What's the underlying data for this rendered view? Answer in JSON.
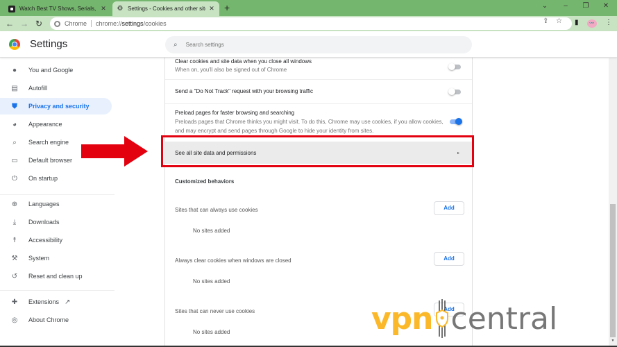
{
  "browser": {
    "tabs": [
      {
        "title": "Watch Best TV Shows, Serials, Sp",
        "icon": "tv-favicon-icon",
        "active": false
      },
      {
        "title": "Settings - Cookies and other site",
        "icon": "gear-icon",
        "active": true
      }
    ],
    "new_tab_symbol": "+",
    "window_controls": {
      "dropdown": "⌄",
      "minimize": "–",
      "restore": "❐",
      "close": "✕"
    },
    "close_symbol": "✕",
    "nav": {
      "back": "←",
      "forward": "→",
      "reload": "↻"
    },
    "omnibox": {
      "chip": "Chrome",
      "url_prefix": "chrome://",
      "url_host": "settings",
      "url_path": "/cookies"
    },
    "toolbar_icons": {
      "share": "⇪",
      "bookmark": "☆",
      "side_panel": "▮",
      "profile": "👓",
      "menu": "⋮"
    }
  },
  "settings": {
    "title": "Settings",
    "search_placeholder": "Search settings",
    "search_icon": "⌕",
    "sidebar": [
      {
        "label": "You and Google",
        "icon": "person-icon",
        "glyph": "👤",
        "selected": false
      },
      {
        "label": "Autofill",
        "icon": "clipboard-icon",
        "glyph": "📋",
        "selected": false
      },
      {
        "label": "Privacy and security",
        "icon": "shield-icon",
        "glyph": "🛡",
        "selected": true
      },
      {
        "label": "Appearance",
        "icon": "palette-icon",
        "glyph": "🎨",
        "selected": false
      },
      {
        "label": "Search engine",
        "icon": "search-icon",
        "glyph": "⌕",
        "selected": false
      },
      {
        "label": "Default browser",
        "icon": "browser-window-icon",
        "glyph": "▭",
        "selected": false
      },
      {
        "label": "On startup",
        "icon": "power-icon",
        "glyph": "⏻",
        "selected": false
      },
      {
        "label": "Languages",
        "icon": "globe-icon",
        "glyph": "🌐",
        "selected": false
      },
      {
        "label": "Downloads",
        "icon": "download-icon",
        "glyph": "⤓",
        "selected": false
      },
      {
        "label": "Accessibility",
        "icon": "accessibility-icon",
        "glyph": "♿",
        "selected": false
      },
      {
        "label": "System",
        "icon": "wrench-icon",
        "glyph": "🔧",
        "selected": false
      },
      {
        "label": "Reset and clean up",
        "icon": "history-icon",
        "glyph": "↺",
        "selected": false
      },
      {
        "label": "Extensions",
        "icon": "puzzle-icon",
        "glyph": "🧩",
        "selected": false,
        "external_link": "↗"
      },
      {
        "label": "About Chrome",
        "icon": "chrome-icon",
        "glyph": "◎",
        "selected": false
      }
    ],
    "content": {
      "clear_on_close": {
        "title": "Clear cookies and site data when you close all windows",
        "subtitle": "When on, you'll also be signed out of Chrome",
        "enabled": false
      },
      "do_not_track": {
        "title": "Send a \"Do Not Track\" request with your browsing traffic",
        "enabled": false
      },
      "preload": {
        "title": "Preload pages for faster browsing and searching",
        "subtitle": "Preloads pages that Chrome thinks you might visit. To do this, Chrome may use cookies, if you allow cookies, and may encrypt and send pages through Google to hide your identity from sites.",
        "enabled": true
      },
      "see_all": {
        "label": "See all site data and permissions",
        "arrow": "▸"
      },
      "customized_heading": "Customized behaviors",
      "lists": [
        {
          "title": "Sites that can always use cookies",
          "add_label": "Add",
          "empty": "No sites added"
        },
        {
          "title": "Always clear cookies when windows are closed",
          "add_label": "Add",
          "empty": "No sites added"
        },
        {
          "title": "Sites that can never use cookies",
          "add_label": "Add",
          "empty": "No sites added"
        }
      ]
    }
  },
  "annotation": {
    "color": "#e3000f"
  },
  "watermark": {
    "part1": "vpn",
    "part2": "central",
    "color1": "#fbb829",
    "color2": "#777777"
  },
  "colors": {
    "accent": "#1a73e8",
    "frame": "#75b66e",
    "toolbar": "#c7e3c2",
    "selected_bg": "#e8f0fe"
  }
}
